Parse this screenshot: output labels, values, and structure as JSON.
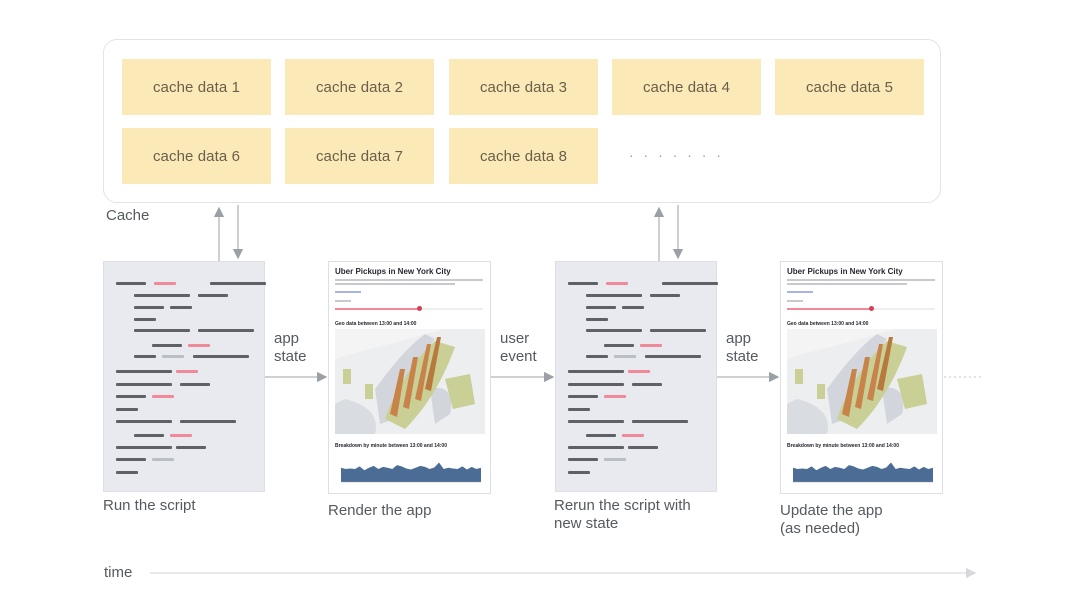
{
  "cache": {
    "label": "Cache",
    "items": [
      "cache data 1",
      "cache data 2",
      "cache data 3",
      "cache data 4",
      "cache data 5",
      "cache data 6",
      "cache data 7",
      "cache data 8"
    ],
    "ellipsis": "· · · · · · ·"
  },
  "steps": [
    {
      "label": "Run the script"
    },
    {
      "label": "Render the app"
    },
    {
      "label": "Rerun the script with",
      "label2": "new state"
    },
    {
      "label": "Update the app",
      "label2": "(as needed)"
    }
  ],
  "transitions": [
    {
      "line1": "app",
      "line2": "state"
    },
    {
      "line1": "user",
      "line2": "event"
    },
    {
      "line1": "app",
      "line2": "state"
    }
  ],
  "app_preview": {
    "title": "Uber Pickups in New York City",
    "map_heading": "Geo data between 13:00 and 14:00",
    "chart_heading": "Breakdown by minute between 13:00 and 14:00",
    "slider_fraction": 0.57
  },
  "timeline": {
    "label": "time"
  },
  "colors": {
    "cache_cell": "#fbeab8",
    "code_dark": "#5f6166",
    "code_highlight": "#f08a98",
    "code_muted": "#b9bfc2",
    "chart_fill": "#4a6c95",
    "arrow": "#9aa0a6"
  }
}
